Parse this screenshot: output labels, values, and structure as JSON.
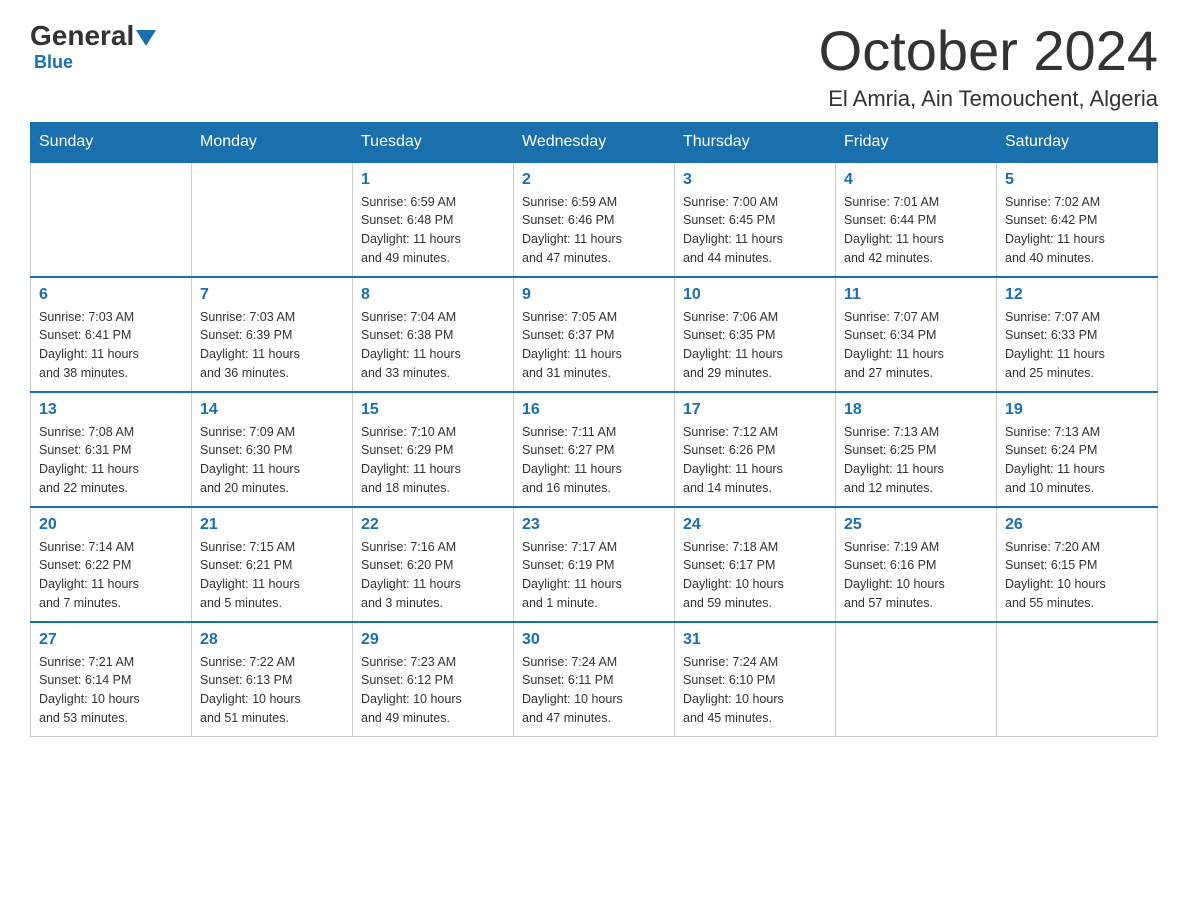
{
  "header": {
    "logo_general": "General",
    "logo_blue": "Blue",
    "title": "October 2024",
    "subtitle": "El Amria, Ain Temouchent, Algeria"
  },
  "days_of_week": [
    "Sunday",
    "Monday",
    "Tuesday",
    "Wednesday",
    "Thursday",
    "Friday",
    "Saturday"
  ],
  "weeks": [
    [
      {
        "day": "",
        "info": ""
      },
      {
        "day": "",
        "info": ""
      },
      {
        "day": "1",
        "info": "Sunrise: 6:59 AM\nSunset: 6:48 PM\nDaylight: 11 hours\nand 49 minutes."
      },
      {
        "day": "2",
        "info": "Sunrise: 6:59 AM\nSunset: 6:46 PM\nDaylight: 11 hours\nand 47 minutes."
      },
      {
        "day": "3",
        "info": "Sunrise: 7:00 AM\nSunset: 6:45 PM\nDaylight: 11 hours\nand 44 minutes."
      },
      {
        "day": "4",
        "info": "Sunrise: 7:01 AM\nSunset: 6:44 PM\nDaylight: 11 hours\nand 42 minutes."
      },
      {
        "day": "5",
        "info": "Sunrise: 7:02 AM\nSunset: 6:42 PM\nDaylight: 11 hours\nand 40 minutes."
      }
    ],
    [
      {
        "day": "6",
        "info": "Sunrise: 7:03 AM\nSunset: 6:41 PM\nDaylight: 11 hours\nand 38 minutes."
      },
      {
        "day": "7",
        "info": "Sunrise: 7:03 AM\nSunset: 6:39 PM\nDaylight: 11 hours\nand 36 minutes."
      },
      {
        "day": "8",
        "info": "Sunrise: 7:04 AM\nSunset: 6:38 PM\nDaylight: 11 hours\nand 33 minutes."
      },
      {
        "day": "9",
        "info": "Sunrise: 7:05 AM\nSunset: 6:37 PM\nDaylight: 11 hours\nand 31 minutes."
      },
      {
        "day": "10",
        "info": "Sunrise: 7:06 AM\nSunset: 6:35 PM\nDaylight: 11 hours\nand 29 minutes."
      },
      {
        "day": "11",
        "info": "Sunrise: 7:07 AM\nSunset: 6:34 PM\nDaylight: 11 hours\nand 27 minutes."
      },
      {
        "day": "12",
        "info": "Sunrise: 7:07 AM\nSunset: 6:33 PM\nDaylight: 11 hours\nand 25 minutes."
      }
    ],
    [
      {
        "day": "13",
        "info": "Sunrise: 7:08 AM\nSunset: 6:31 PM\nDaylight: 11 hours\nand 22 minutes."
      },
      {
        "day": "14",
        "info": "Sunrise: 7:09 AM\nSunset: 6:30 PM\nDaylight: 11 hours\nand 20 minutes."
      },
      {
        "day": "15",
        "info": "Sunrise: 7:10 AM\nSunset: 6:29 PM\nDaylight: 11 hours\nand 18 minutes."
      },
      {
        "day": "16",
        "info": "Sunrise: 7:11 AM\nSunset: 6:27 PM\nDaylight: 11 hours\nand 16 minutes."
      },
      {
        "day": "17",
        "info": "Sunrise: 7:12 AM\nSunset: 6:26 PM\nDaylight: 11 hours\nand 14 minutes."
      },
      {
        "day": "18",
        "info": "Sunrise: 7:13 AM\nSunset: 6:25 PM\nDaylight: 11 hours\nand 12 minutes."
      },
      {
        "day": "19",
        "info": "Sunrise: 7:13 AM\nSunset: 6:24 PM\nDaylight: 11 hours\nand 10 minutes."
      }
    ],
    [
      {
        "day": "20",
        "info": "Sunrise: 7:14 AM\nSunset: 6:22 PM\nDaylight: 11 hours\nand 7 minutes."
      },
      {
        "day": "21",
        "info": "Sunrise: 7:15 AM\nSunset: 6:21 PM\nDaylight: 11 hours\nand 5 minutes."
      },
      {
        "day": "22",
        "info": "Sunrise: 7:16 AM\nSunset: 6:20 PM\nDaylight: 11 hours\nand 3 minutes."
      },
      {
        "day": "23",
        "info": "Sunrise: 7:17 AM\nSunset: 6:19 PM\nDaylight: 11 hours\nand 1 minute."
      },
      {
        "day": "24",
        "info": "Sunrise: 7:18 AM\nSunset: 6:17 PM\nDaylight: 10 hours\nand 59 minutes."
      },
      {
        "day": "25",
        "info": "Sunrise: 7:19 AM\nSunset: 6:16 PM\nDaylight: 10 hours\nand 57 minutes."
      },
      {
        "day": "26",
        "info": "Sunrise: 7:20 AM\nSunset: 6:15 PM\nDaylight: 10 hours\nand 55 minutes."
      }
    ],
    [
      {
        "day": "27",
        "info": "Sunrise: 7:21 AM\nSunset: 6:14 PM\nDaylight: 10 hours\nand 53 minutes."
      },
      {
        "day": "28",
        "info": "Sunrise: 7:22 AM\nSunset: 6:13 PM\nDaylight: 10 hours\nand 51 minutes."
      },
      {
        "day": "29",
        "info": "Sunrise: 7:23 AM\nSunset: 6:12 PM\nDaylight: 10 hours\nand 49 minutes."
      },
      {
        "day": "30",
        "info": "Sunrise: 7:24 AM\nSunset: 6:11 PM\nDaylight: 10 hours\nand 47 minutes."
      },
      {
        "day": "31",
        "info": "Sunrise: 7:24 AM\nSunset: 6:10 PM\nDaylight: 10 hours\nand 45 minutes."
      },
      {
        "day": "",
        "info": ""
      },
      {
        "day": "",
        "info": ""
      }
    ]
  ]
}
